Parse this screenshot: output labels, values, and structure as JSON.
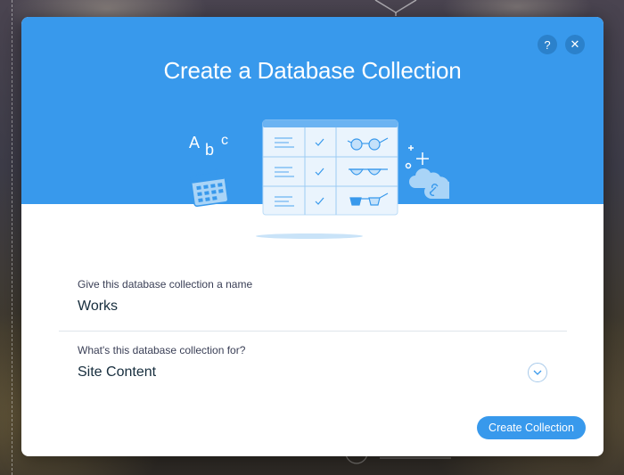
{
  "modal": {
    "title": "Create a Database Collection",
    "help_label": "?",
    "close_label": "✕",
    "illustration": {
      "letters": [
        "A",
        "b",
        "c"
      ],
      "icons": [
        "calendar-icon",
        "text-lines-icon",
        "checkmark-icon",
        "glasses-icon",
        "plus-icon",
        "link-cloud-icon"
      ]
    },
    "name_field": {
      "label": "Give this database collection a name",
      "value": "Works"
    },
    "purpose_field": {
      "label": "What's this database collection for?",
      "value": "Site Content"
    },
    "create_button_label": "Create Collection"
  },
  "colors": {
    "header_blue": "#3899ec",
    "header_button": "#2b81cb",
    "text_dark": "#162d3d",
    "text_label": "#3b4057",
    "divider": "#dfe5eb"
  }
}
